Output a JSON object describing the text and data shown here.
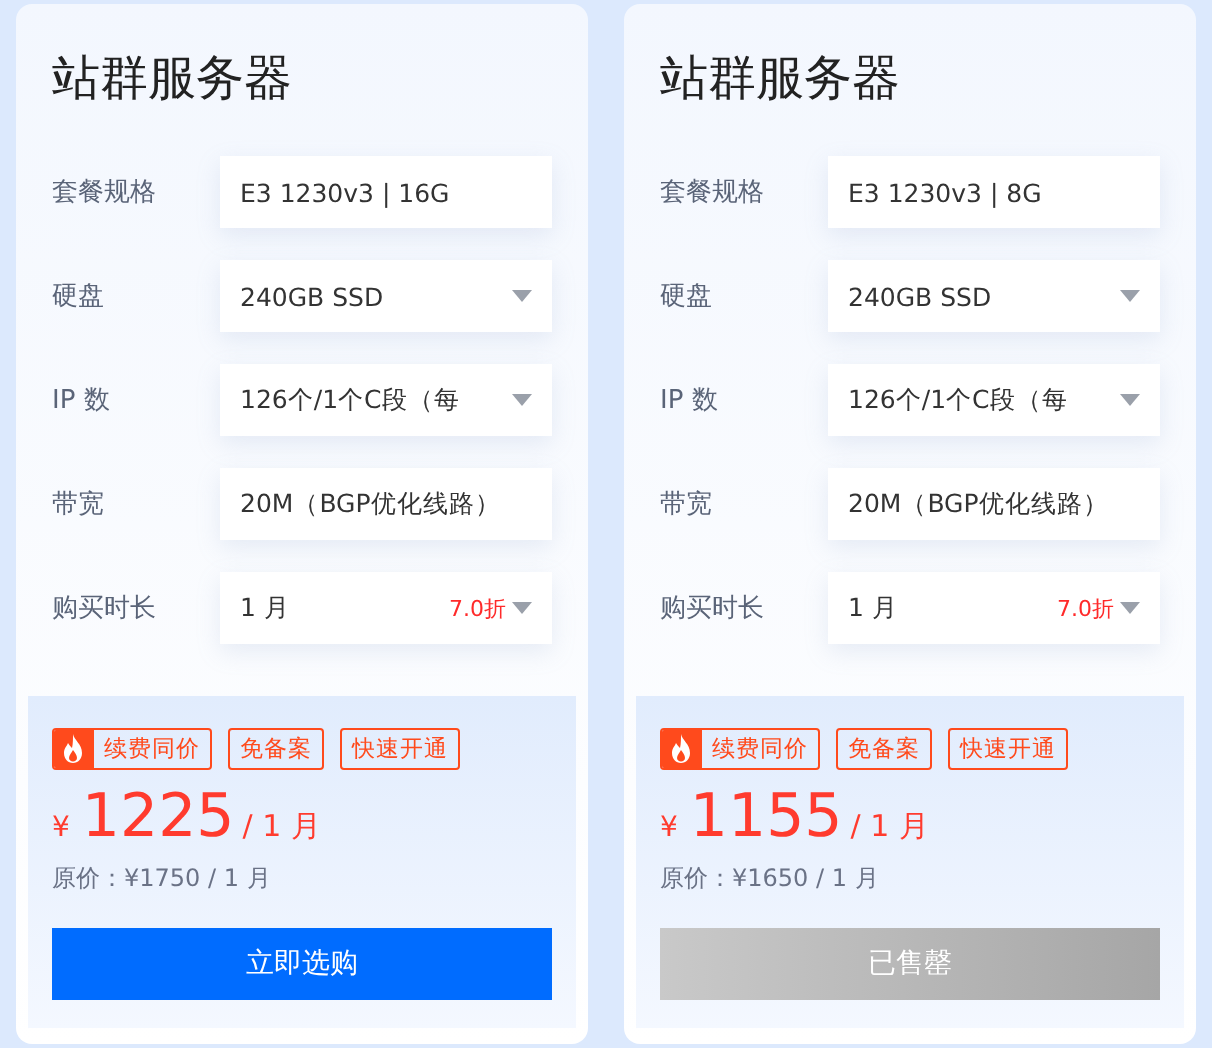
{
  "cards": [
    {
      "title": "站群服务器",
      "fields": [
        {
          "label": "套餐规格",
          "kind": "text",
          "value": "E3 1230v3 | 16G"
        },
        {
          "label": "硬盘",
          "kind": "select",
          "value": "240GB SSD"
        },
        {
          "label": "IP 数",
          "kind": "select",
          "value": "126个/1个C段（每"
        },
        {
          "label": "带宽",
          "kind": "text",
          "value": "20M（BGP优化线路）"
        },
        {
          "label": "购买时长",
          "kind": "select",
          "value": "1 月",
          "discount": "7.0折"
        }
      ],
      "tags": [
        {
          "label": "续费同价",
          "hot": true
        },
        {
          "label": "免备案",
          "hot": false
        },
        {
          "label": "快速开通",
          "hot": false
        }
      ],
      "currency": "¥",
      "price": "1225",
      "period": "/ 1 月",
      "original_price": "原价：¥1750 / 1 月",
      "button": {
        "label": "立即选购",
        "sold_out": false
      }
    },
    {
      "title": "站群服务器",
      "fields": [
        {
          "label": "套餐规格",
          "kind": "text",
          "value": "E3 1230v3 | 8G"
        },
        {
          "label": "硬盘",
          "kind": "select",
          "value": "240GB SSD"
        },
        {
          "label": "IP 数",
          "kind": "select",
          "value": "126个/1个C段（每"
        },
        {
          "label": "带宽",
          "kind": "text",
          "value": "20M（BGP优化线路）"
        },
        {
          "label": "购买时长",
          "kind": "select",
          "value": "1 月",
          "discount": "7.0折"
        }
      ],
      "tags": [
        {
          "label": "续费同价",
          "hot": true
        },
        {
          "label": "免备案",
          "hot": false
        },
        {
          "label": "快速开通",
          "hot": false
        }
      ],
      "currency": "¥",
      "price": "1155",
      "period": "/ 1 月",
      "original_price": "原价：¥1650 / 1 月",
      "button": {
        "label": "已售罄",
        "sold_out": true
      }
    }
  ]
}
